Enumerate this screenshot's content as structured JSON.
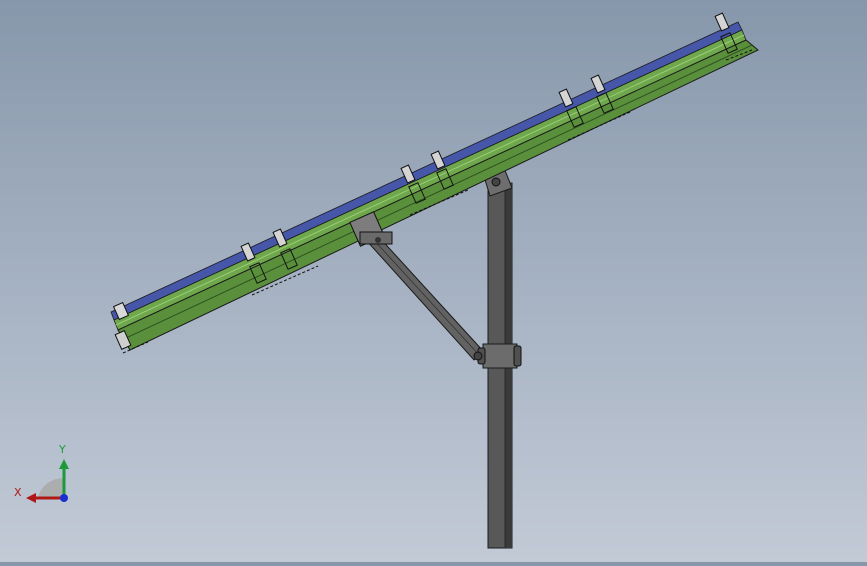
{
  "triad": {
    "x_label": "X",
    "y_label": "Y",
    "colors": {
      "x_axis": "#b01818",
      "y_axis": "#1c9a3a",
      "z_axis": "#1a2fd0",
      "plane": "#a9a9a9"
    }
  },
  "model": {
    "colors": {
      "background_top": "#8797ab",
      "background_bottom": "#c2cad6",
      "rail": "#5a8f3c",
      "rail_shadow": "#2f5320",
      "rail_highlight": "#86bd63",
      "panel_edge": "#4656a8",
      "post": "#565656",
      "post_dark": "#2e2e2e",
      "brace": "#5f5f5f",
      "bracket": "#707070",
      "outline": "#1a1a1a"
    }
  }
}
